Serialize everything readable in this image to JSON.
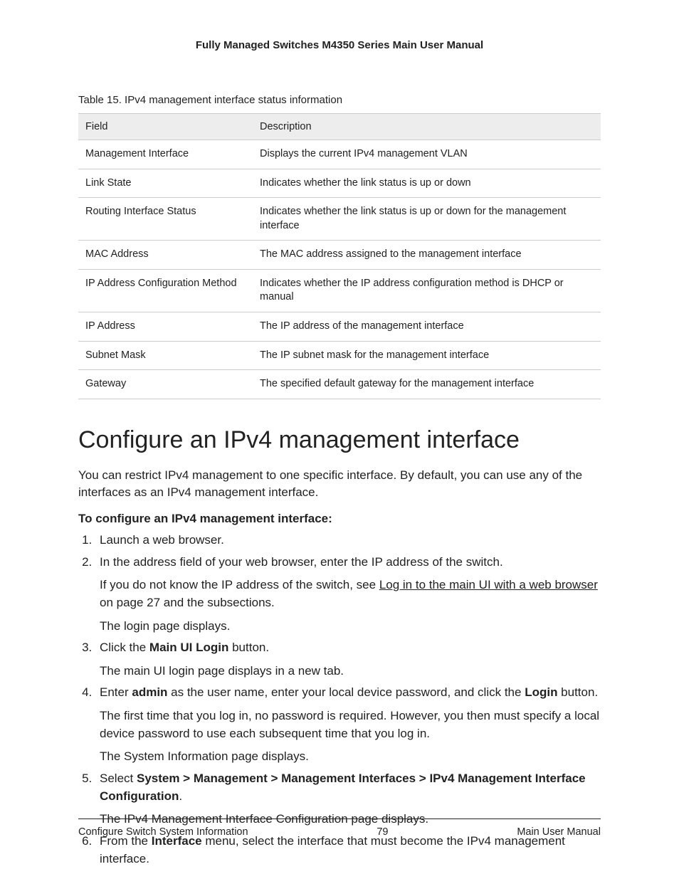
{
  "header": {
    "title": "Fully Managed Switches M4350 Series Main User Manual"
  },
  "table": {
    "caption": "Table 15. IPv4 management interface status information",
    "header_field": "Field",
    "header_desc": "Description",
    "rows": [
      {
        "field": "Management Interface",
        "desc": "Displays the current IPv4 management VLAN"
      },
      {
        "field": "Link State",
        "desc": "Indicates whether the link status is up or down"
      },
      {
        "field": "Routing Interface Status",
        "desc": "Indicates whether the link status is up or down for the management interface"
      },
      {
        "field": "MAC Address",
        "desc": "The MAC address assigned to the management interface"
      },
      {
        "field": "IP Address Configuration Method",
        "desc": "Indicates whether the IP address configuration method is DHCP or manual"
      },
      {
        "field": "IP Address",
        "desc": "The IP address of the management interface"
      },
      {
        "field": "Subnet Mask",
        "desc": "The IP subnet mask for the management interface"
      },
      {
        "field": "Gateway",
        "desc": "The specified default gateway for the management interface"
      }
    ]
  },
  "heading": "Configure an IPv4 management interface",
  "intro": "You can restrict IPv4 management to one specific interface. By default, you can use any of the interfaces as an IPv4 management interface.",
  "subhead": "To configure an IPv4 management interface:",
  "steps": {
    "s1": "Launch a web browser.",
    "s2": "In the address field of your web browser, enter the IP address of the switch.",
    "s2_p1_a": "If you do not know the IP address of the switch, see ",
    "s2_p1_link": "Log in to the main UI with a web browser",
    "s2_p1_b": " on page 27 and the subsections.",
    "s2_p2": "The login page displays.",
    "s3_a": "Click the ",
    "s3_b": "Main UI Login",
    "s3_c": " button.",
    "s3_p1": "The main UI login page displays in a new tab.",
    "s4_a": "Enter ",
    "s4_b": "admin",
    "s4_c": " as the user name, enter your local device password, and click the ",
    "s4_d": "Login",
    "s4_e": " button.",
    "s4_p1": "The first time that you log in, no password is required. However, you then must specify a local device password to use each subsequent time that you log in.",
    "s4_p2": "The System Information page displays.",
    "s5_a": "Select ",
    "s5_b": "System > Management > Management Interfaces > IPv4 Management Interface Configuration",
    "s5_c": ".",
    "s5_p1": "The IPv4 Management Interface Configuration page displays.",
    "s6_a": "From the ",
    "s6_b": "Interface",
    "s6_c": " menu, select the interface that must become the IPv4 management interface."
  },
  "footer": {
    "left": "Configure Switch System Information",
    "center": "79",
    "right": "Main User Manual"
  }
}
